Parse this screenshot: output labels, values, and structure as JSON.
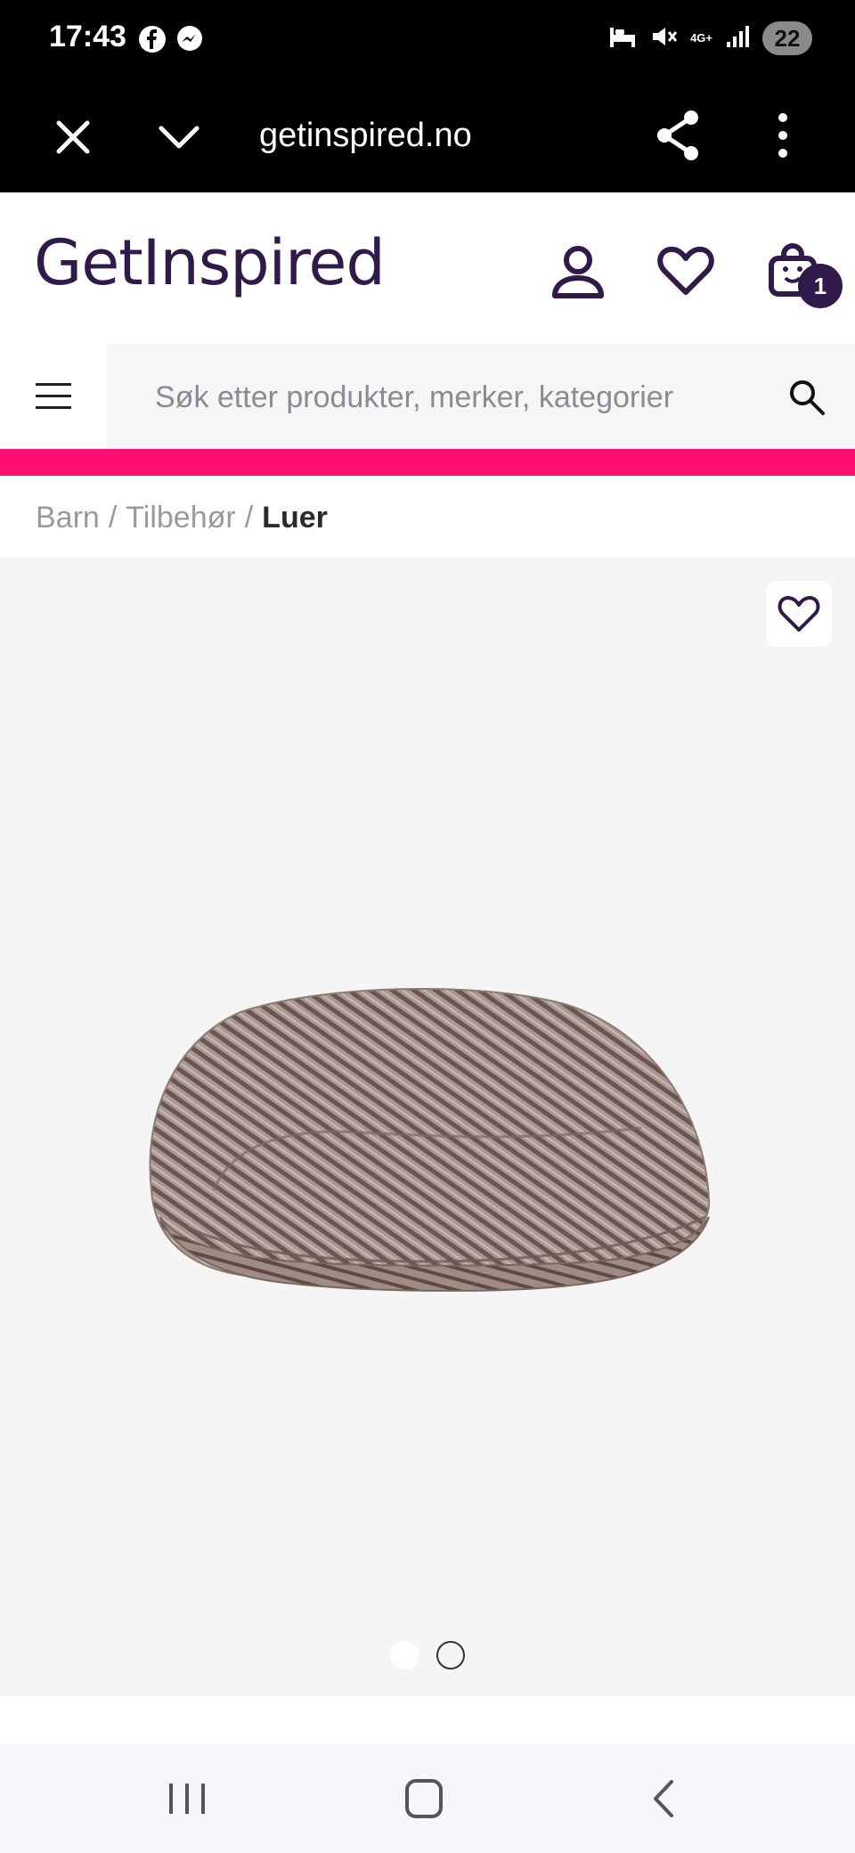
{
  "status_bar": {
    "time": "17:43",
    "network": "4G+",
    "battery": "22",
    "left_icons": [
      "facebook-icon",
      "messenger-icon"
    ],
    "right_icons": [
      "sleep-icon",
      "mute-icon",
      "signal-icon"
    ]
  },
  "browser": {
    "url": "getinspired.no",
    "icons": [
      "close-icon",
      "chevron-down-icon",
      "share-icon",
      "more-icon"
    ]
  },
  "header": {
    "logo": "GetInspired",
    "cart_count": "1",
    "icons": [
      "account-icon",
      "heart-icon",
      "cart-icon"
    ],
    "brand_color": "#2f1a4a"
  },
  "search": {
    "placeholder": "Søk etter produkter, merker, kategorier",
    "value": ""
  },
  "accent_color": "#ff0f6f",
  "breadcrumb": {
    "items": [
      "Barn",
      "Tilbehør"
    ],
    "separator": "/",
    "current": "Luer"
  },
  "product": {
    "image_count": 2,
    "active_image": 1
  },
  "navigation": {
    "icons": [
      "recent-apps-icon",
      "home-icon",
      "back-icon"
    ]
  }
}
